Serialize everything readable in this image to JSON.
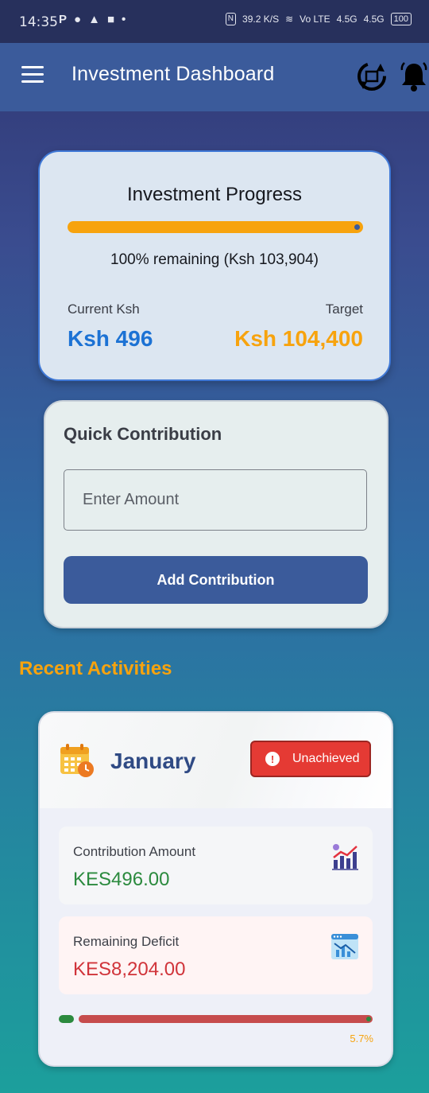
{
  "status_bar": {
    "time": "14:35",
    "left_icons": [
      "P",
      "messenger-icon",
      "snapchat-icon",
      "linkedin-icon",
      "dot-icon"
    ],
    "net_speed": "39.2",
    "net_speed_unit": "K/S",
    "volte": "Vo LTE",
    "signal1": "4.5G",
    "signal2": "4.5G",
    "battery": "100"
  },
  "appbar": {
    "title": "Investment Dashboard",
    "icons": [
      "menu-icon",
      "sync-icon",
      "bell-icon"
    ]
  },
  "progress": {
    "title": "Investment Progress",
    "remaining_percent": 100,
    "remaining_text": "100% remaining (Ksh 103,904)",
    "current_label": "Current Ksh",
    "current_value": "Ksh 496",
    "target_label": "Target",
    "target_value": "Ksh 104,400"
  },
  "quick": {
    "title": "Quick Contribution",
    "input_placeholder": "Enter Amount",
    "input_value": "",
    "button_label": "Add Contribution"
  },
  "recent": {
    "title": "Recent Activities",
    "activity": {
      "month": "January",
      "status": "Unachieved",
      "contribution_label": "Contribution Amount",
      "contribution_value": "KES496.00",
      "deficit_label": "Remaining Deficit",
      "deficit_value": "KES8,204.00",
      "progress_percent": "5.7%"
    }
  },
  "colors": {
    "primary": "#3b5b9b",
    "accent": "#f7a30e",
    "current": "#1c72d4",
    "success": "#2b8a3e",
    "danger": "#e53a34"
  }
}
